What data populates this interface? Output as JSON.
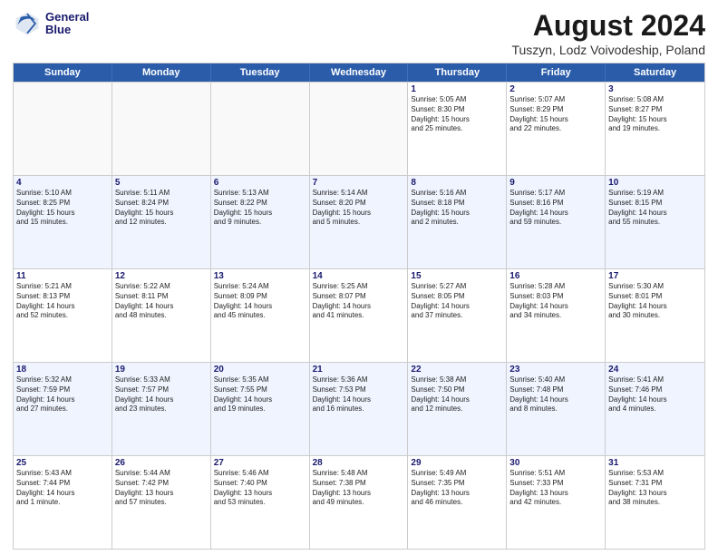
{
  "header": {
    "logo_line1": "General",
    "logo_line2": "Blue",
    "main_title": "August 2024",
    "subtitle": "Tuszyn, Lodz Voivodeship, Poland"
  },
  "weekdays": [
    "Sunday",
    "Monday",
    "Tuesday",
    "Wednesday",
    "Thursday",
    "Friday",
    "Saturday"
  ],
  "rows": [
    {
      "alt": false,
      "cells": [
        {
          "day": "",
          "text": ""
        },
        {
          "day": "",
          "text": ""
        },
        {
          "day": "",
          "text": ""
        },
        {
          "day": "",
          "text": ""
        },
        {
          "day": "1",
          "text": "Sunrise: 5:05 AM\nSunset: 8:30 PM\nDaylight: 15 hours\nand 25 minutes."
        },
        {
          "day": "2",
          "text": "Sunrise: 5:07 AM\nSunset: 8:29 PM\nDaylight: 15 hours\nand 22 minutes."
        },
        {
          "day": "3",
          "text": "Sunrise: 5:08 AM\nSunset: 8:27 PM\nDaylight: 15 hours\nand 19 minutes."
        }
      ]
    },
    {
      "alt": true,
      "cells": [
        {
          "day": "4",
          "text": "Sunrise: 5:10 AM\nSunset: 8:25 PM\nDaylight: 15 hours\nand 15 minutes."
        },
        {
          "day": "5",
          "text": "Sunrise: 5:11 AM\nSunset: 8:24 PM\nDaylight: 15 hours\nand 12 minutes."
        },
        {
          "day": "6",
          "text": "Sunrise: 5:13 AM\nSunset: 8:22 PM\nDaylight: 15 hours\nand 9 minutes."
        },
        {
          "day": "7",
          "text": "Sunrise: 5:14 AM\nSunset: 8:20 PM\nDaylight: 15 hours\nand 5 minutes."
        },
        {
          "day": "8",
          "text": "Sunrise: 5:16 AM\nSunset: 8:18 PM\nDaylight: 15 hours\nand 2 minutes."
        },
        {
          "day": "9",
          "text": "Sunrise: 5:17 AM\nSunset: 8:16 PM\nDaylight: 14 hours\nand 59 minutes."
        },
        {
          "day": "10",
          "text": "Sunrise: 5:19 AM\nSunset: 8:15 PM\nDaylight: 14 hours\nand 55 minutes."
        }
      ]
    },
    {
      "alt": false,
      "cells": [
        {
          "day": "11",
          "text": "Sunrise: 5:21 AM\nSunset: 8:13 PM\nDaylight: 14 hours\nand 52 minutes."
        },
        {
          "day": "12",
          "text": "Sunrise: 5:22 AM\nSunset: 8:11 PM\nDaylight: 14 hours\nand 48 minutes."
        },
        {
          "day": "13",
          "text": "Sunrise: 5:24 AM\nSunset: 8:09 PM\nDaylight: 14 hours\nand 45 minutes."
        },
        {
          "day": "14",
          "text": "Sunrise: 5:25 AM\nSunset: 8:07 PM\nDaylight: 14 hours\nand 41 minutes."
        },
        {
          "day": "15",
          "text": "Sunrise: 5:27 AM\nSunset: 8:05 PM\nDaylight: 14 hours\nand 37 minutes."
        },
        {
          "day": "16",
          "text": "Sunrise: 5:28 AM\nSunset: 8:03 PM\nDaylight: 14 hours\nand 34 minutes."
        },
        {
          "day": "17",
          "text": "Sunrise: 5:30 AM\nSunset: 8:01 PM\nDaylight: 14 hours\nand 30 minutes."
        }
      ]
    },
    {
      "alt": true,
      "cells": [
        {
          "day": "18",
          "text": "Sunrise: 5:32 AM\nSunset: 7:59 PM\nDaylight: 14 hours\nand 27 minutes."
        },
        {
          "day": "19",
          "text": "Sunrise: 5:33 AM\nSunset: 7:57 PM\nDaylight: 14 hours\nand 23 minutes."
        },
        {
          "day": "20",
          "text": "Sunrise: 5:35 AM\nSunset: 7:55 PM\nDaylight: 14 hours\nand 19 minutes."
        },
        {
          "day": "21",
          "text": "Sunrise: 5:36 AM\nSunset: 7:53 PM\nDaylight: 14 hours\nand 16 minutes."
        },
        {
          "day": "22",
          "text": "Sunrise: 5:38 AM\nSunset: 7:50 PM\nDaylight: 14 hours\nand 12 minutes."
        },
        {
          "day": "23",
          "text": "Sunrise: 5:40 AM\nSunset: 7:48 PM\nDaylight: 14 hours\nand 8 minutes."
        },
        {
          "day": "24",
          "text": "Sunrise: 5:41 AM\nSunset: 7:46 PM\nDaylight: 14 hours\nand 4 minutes."
        }
      ]
    },
    {
      "alt": false,
      "cells": [
        {
          "day": "25",
          "text": "Sunrise: 5:43 AM\nSunset: 7:44 PM\nDaylight: 14 hours\nand 1 minute."
        },
        {
          "day": "26",
          "text": "Sunrise: 5:44 AM\nSunset: 7:42 PM\nDaylight: 13 hours\nand 57 minutes."
        },
        {
          "day": "27",
          "text": "Sunrise: 5:46 AM\nSunset: 7:40 PM\nDaylight: 13 hours\nand 53 minutes."
        },
        {
          "day": "28",
          "text": "Sunrise: 5:48 AM\nSunset: 7:38 PM\nDaylight: 13 hours\nand 49 minutes."
        },
        {
          "day": "29",
          "text": "Sunrise: 5:49 AM\nSunset: 7:35 PM\nDaylight: 13 hours\nand 46 minutes."
        },
        {
          "day": "30",
          "text": "Sunrise: 5:51 AM\nSunset: 7:33 PM\nDaylight: 13 hours\nand 42 minutes."
        },
        {
          "day": "31",
          "text": "Sunrise: 5:53 AM\nSunset: 7:31 PM\nDaylight: 13 hours\nand 38 minutes."
        }
      ]
    }
  ]
}
